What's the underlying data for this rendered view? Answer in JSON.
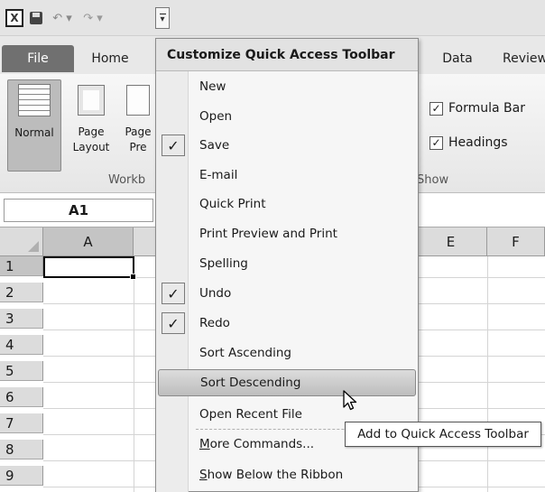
{
  "qat": {
    "excel_icon_glyph": "X",
    "undo_glyph": "↶ ▾",
    "redo_glyph": "↷ ▾",
    "dropdown_glyph": "▾"
  },
  "tabs": {
    "file": "File",
    "home": "Home",
    "data": "Data",
    "review": "Review"
  },
  "ribbon": {
    "normal": "Normal",
    "page_layout_1": "Page",
    "page_layout_2": "Layout",
    "page_break_1": "Page",
    "page_break_2": "Pre",
    "workbook_group": "Workb",
    "show_group": "Show",
    "formula_bar": "Formula Bar",
    "headings": "Headings",
    "check_glyph": "✓"
  },
  "formula_bar": {
    "name_box": "A1"
  },
  "grid": {
    "columns": [
      "A",
      "E",
      "F"
    ],
    "rows": [
      "1",
      "2",
      "3",
      "4",
      "5",
      "6",
      "7",
      "8",
      "9"
    ]
  },
  "menu": {
    "title": "Customize Quick Access Toolbar",
    "check_glyph": "✓",
    "items": [
      {
        "label": "New",
        "checked": false
      },
      {
        "label": "Open",
        "checked": false
      },
      {
        "label": "Save",
        "checked": true
      },
      {
        "label": "E-mail",
        "checked": false
      },
      {
        "label": "Quick Print",
        "checked": false
      },
      {
        "label": "Print Preview and Print",
        "checked": false
      },
      {
        "label": "Spelling",
        "checked": false
      },
      {
        "label": "Undo",
        "checked": true
      },
      {
        "label": "Redo",
        "checked": true
      },
      {
        "label": "Sort Ascending",
        "checked": false
      },
      {
        "label": "Sort Descending",
        "checked": false
      },
      {
        "label": "Open Recent File",
        "checked": false
      }
    ],
    "more_commands_first": "M",
    "more_commands_rest": "ore Commands...",
    "show_below_first": "S",
    "show_below_rest": "how Below the Ribbon"
  },
  "tooltip": {
    "text": "Add to Quick Access Toolbar"
  }
}
